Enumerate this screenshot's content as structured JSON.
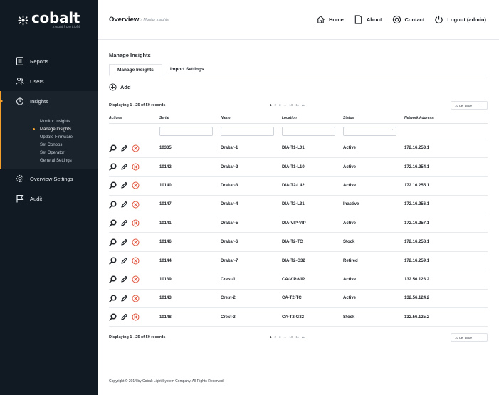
{
  "brand": {
    "name": "cobalt",
    "tagline": "Insight from Light"
  },
  "sidebar": {
    "items": [
      {
        "label": "Reports",
        "icon": "reports-icon"
      },
      {
        "label": "Users",
        "icon": "users-icon"
      },
      {
        "label": "Insights",
        "icon": "insights-icon",
        "active": true
      },
      {
        "label": "Overview Settings",
        "icon": "overview-settings-icon"
      },
      {
        "label": "Audit",
        "icon": "audit-flag-icon"
      }
    ],
    "insights_subitems": [
      {
        "label": "Monitor Insights"
      },
      {
        "label": "Manage Insights",
        "current": true
      },
      {
        "label": "Update Firmware"
      },
      {
        "label": "Set Conops"
      },
      {
        "label": "Set Operator"
      },
      {
        "label": "General Settings"
      }
    ]
  },
  "header": {
    "title": "Overview",
    "breadcrumb_sub": "> Monitor Insights",
    "nav": [
      {
        "label": "Home",
        "icon": "home-icon"
      },
      {
        "label": "About",
        "icon": "about-icon"
      },
      {
        "label": "Contact",
        "icon": "contact-icon"
      },
      {
        "label": "Logout (admin)",
        "icon": "power-icon"
      }
    ]
  },
  "page": {
    "section_title": "Manage Insights",
    "tabs": [
      {
        "label": "Manage Insights",
        "active": true
      },
      {
        "label": "Import Settings"
      }
    ],
    "add_label": "Add"
  },
  "pagination": {
    "records_text": "Displaying 1 - 25 of 50 records",
    "pages": [
      "1",
      "2",
      "3",
      "...",
      "10",
      "11",
      "▸▸"
    ],
    "current_page": "1",
    "per_page": "10 per page"
  },
  "table": {
    "columns": [
      "Actions",
      "Serial",
      "Name",
      "Location",
      "Status",
      "Network Address"
    ],
    "rows": [
      {
        "serial": "10335",
        "name": "Drakar-1",
        "location": "DIA-T1-L01",
        "status": "Active",
        "network": "172.16.253.1"
      },
      {
        "serial": "10142",
        "name": "Drakar-2",
        "location": "DIA-T1-L10",
        "status": "Active",
        "network": "172.16.254.1"
      },
      {
        "serial": "10140",
        "name": "Drakar-3",
        "location": "DIA-T2-L42",
        "status": "Active",
        "network": "172.16.255.1"
      },
      {
        "serial": "10147",
        "name": "Drakar-4",
        "location": "DIA-T2-L31",
        "status": "Inactive",
        "network": "172.16.256.1"
      },
      {
        "serial": "10141",
        "name": "Drakar-5",
        "location": "DIA-VIP-VIP",
        "status": "Active",
        "network": "172.16.257.1"
      },
      {
        "serial": "10146",
        "name": "Drakar-6",
        "location": "DIA-T2-TC",
        "status": "Stock",
        "network": "172.16.258.1"
      },
      {
        "serial": "10144",
        "name": "Drakar-7",
        "location": "DIA-T2-G32",
        "status": "Retired",
        "network": "172.16.259.1"
      },
      {
        "serial": "10139",
        "name": "Crest-1",
        "location": "CA-VIP-VIP",
        "status": "Active",
        "network": "132.56.123.2"
      },
      {
        "serial": "10143",
        "name": "Crest-2",
        "location": "CA-T2-TC",
        "status": "Active",
        "network": "132.56.124.2"
      },
      {
        "serial": "10148",
        "name": "Crest-3",
        "location": "CA-T2-G32",
        "status": "Stock",
        "network": "132.56.125.2"
      }
    ]
  },
  "footer": {
    "copyright": "Copyright © 2014 by Cobalt Light System Company. All Rights Reserved."
  },
  "colors": {
    "sidebar_bg": "#111a22",
    "accent": "#f2a02b",
    "delete": "#e0513a"
  }
}
